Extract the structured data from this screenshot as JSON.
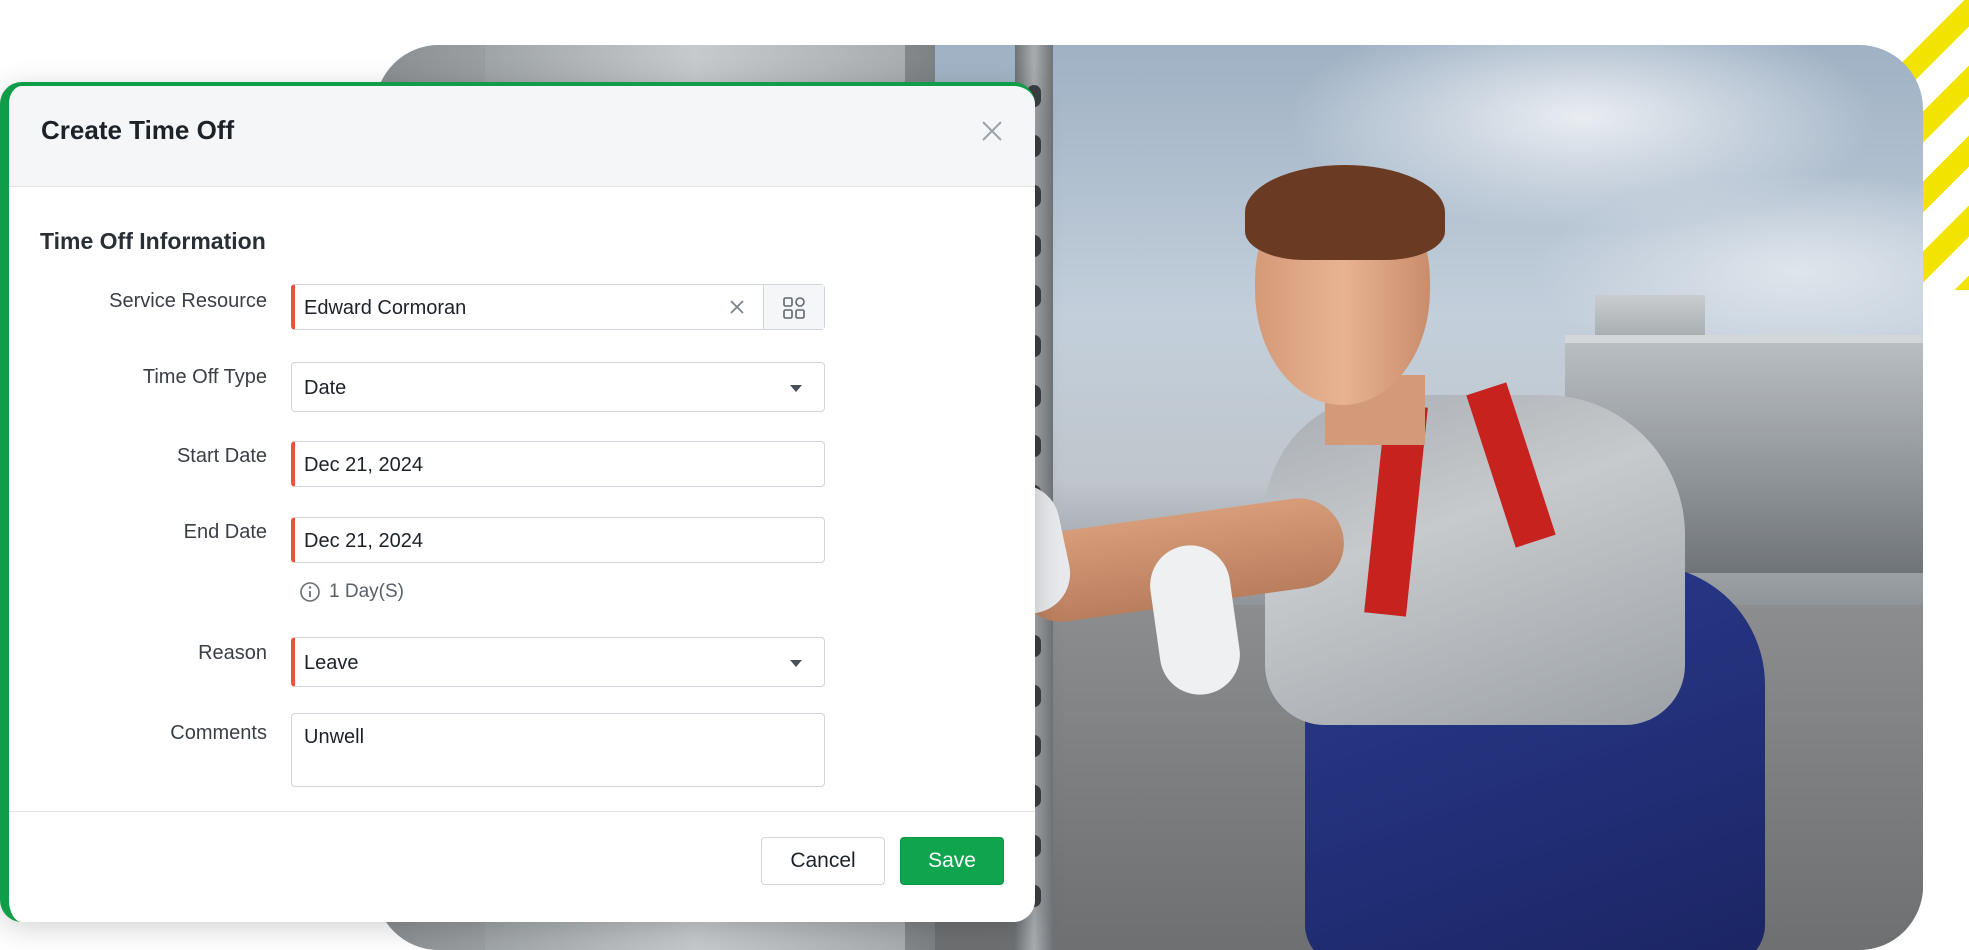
{
  "dialog": {
    "title": "Create Time Off",
    "section_title": "Time Off Information",
    "fields": {
      "service_resource": {
        "label": "Service Resource",
        "value": "Edward Cormoran"
      },
      "time_off_type": {
        "label": "Time Off Type",
        "value": "Date"
      },
      "start_date": {
        "label": "Start Date",
        "value": "Dec 21, 2024"
      },
      "end_date": {
        "label": "End Date",
        "value": "Dec 21, 2024",
        "hint": "1 Day(S)"
      },
      "reason": {
        "label": "Reason",
        "value": "Leave"
      },
      "comments": {
        "label": "Comments",
        "value": "Unwell"
      }
    },
    "buttons": {
      "cancel": "Cancel",
      "save": "Save"
    }
  },
  "colors": {
    "accent_green": "#0fa44e",
    "required_marker": "#e8553e",
    "decor_yellow": "#f2e400"
  }
}
